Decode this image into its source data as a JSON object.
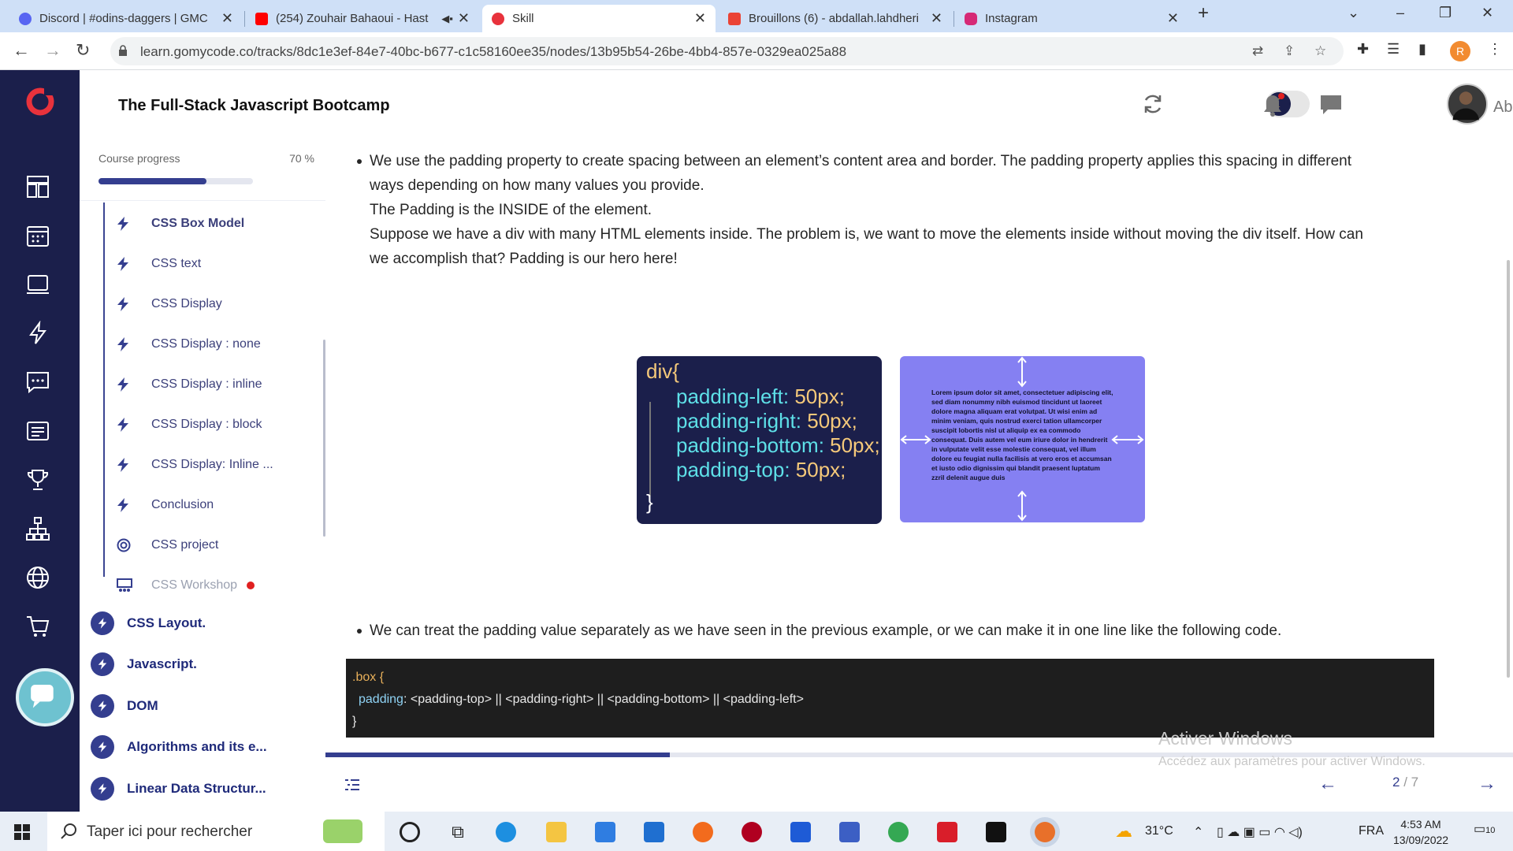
{
  "browser": {
    "tabs": [
      {
        "title": "Discord | #odins-daggers | GMC",
        "favicon": "discord-icon",
        "color": "#5865f2"
      },
      {
        "title": "(254) Zouhair Bahaoui - Hast",
        "favicon": "youtube-icon",
        "color": "#ff0000"
      },
      {
        "title": "Skill",
        "favicon": "gomycode-icon",
        "color": "#e8323c"
      },
      {
        "title": "Brouillons (6) - abdallah.lahdheri",
        "favicon": "gmail-icon",
        "color": "#ea4335"
      },
      {
        "title": "Instagram",
        "favicon": "instagram-icon",
        "color": "#d62976"
      }
    ],
    "url": "learn.gomycode.co/tracks/8dc1e3ef-84e7-40bc-b677-c1c58160ee35/nodes/13b95b54-26be-4bb4-857e-0329ea025a88",
    "profile_initial": "R"
  },
  "header": {
    "course_title": "The Full-Stack Javascript Bootcamp",
    "username": "Abdallah"
  },
  "sidebar": {
    "progress_label": "Course progress",
    "progress_text": "70 %",
    "progress": 0.7,
    "lessons": [
      {
        "label": "CSS Box Model",
        "icon": "bolt-icon",
        "state": "current"
      },
      {
        "label": "CSS text",
        "icon": "bolt-icon",
        "state": "normal"
      },
      {
        "label": "CSS Display",
        "icon": "bolt-icon",
        "state": "normal"
      },
      {
        "label": "CSS Display : none",
        "icon": "bolt-icon",
        "state": "normal"
      },
      {
        "label": "CSS Display : inline",
        "icon": "bolt-icon",
        "state": "normal"
      },
      {
        "label": "CSS Display : block",
        "icon": "bolt-icon",
        "state": "normal"
      },
      {
        "label": "CSS Display: Inline ...",
        "icon": "bolt-icon",
        "state": "normal"
      },
      {
        "label": "Conclusion",
        "icon": "bolt-icon",
        "state": "normal"
      },
      {
        "label": "CSS project",
        "icon": "target-icon",
        "state": "normal"
      },
      {
        "label": "CSS Workshop",
        "icon": "workshop-icon",
        "state": "locked"
      }
    ],
    "modules": [
      {
        "label": "CSS Layout."
      },
      {
        "label": "Javascript."
      },
      {
        "label": "DOM"
      },
      {
        "label": "Algorithms and its e..."
      },
      {
        "label": "Linear Data Structur..."
      }
    ]
  },
  "content": {
    "para1_l1": "We use the padding property to create spacing between an element’s content area and border. The padding property applies this spacing in different",
    "para1_l2": "ways depending on how many values you provide.",
    "para1_l3": "The Padding is the INSIDE of the element.",
    "para1_l4": "Suppose we have a div with many HTML elements inside. The problem is, we want to move the elements inside without moving the div itself. How can",
    "para1_l5": "we accomplish that? Padding is our hero here!",
    "image_code": {
      "open": "div{",
      "lines": [
        {
          "prop": "padding-left",
          "val": "50px;"
        },
        {
          "prop": "padding-right",
          "val": "50px;"
        },
        {
          "prop": "padding-bottom",
          "val": "50px;"
        },
        {
          "prop": "padding-top",
          "val": "50px;"
        }
      ],
      "close": "}"
    },
    "lorem": "Lorem ipsum dolor sit amet, consectetuer adipiscing elit, sed diam nonummy nibh euismod tincidunt ut laoreet dolore magna aliquam erat volutpat. Ut wisi enim ad minim veniam, quis nostrud exerci tation ullamcorper suscipit lobortis nisl ut aliquip ex ea commodo consequat. Duis autem vel eum iriure dolor in hendrerit in vulputate velit esse molestie consequat, vel illum dolore eu feugiat nulla facilisis at vero eros et accumsan et iusto odio dignissim qui blandit praesent luptatum zzril delenit augue duis",
    "para2": "We can treat the padding value separately as we have seen in the previous example, or we can make it in one line like the following code.",
    "snippet": {
      "selector": ".box {",
      "prop": "padding",
      "value": ": <padding-top> || <padding-right> || <padding-bottom> || <padding-left>",
      "close": "}"
    },
    "content_progress": 0.29,
    "page_current": "2",
    "page_total": " / 7"
  },
  "watermark": {
    "title": "Activer Windows",
    "subtitle": "Accédez aux paramètres pour activer Windows."
  },
  "taskbar": {
    "search_placeholder": "Taper ici pour rechercher",
    "temperature": "31°C",
    "language": "FRA",
    "time": "4:53 AM",
    "date": "13/09/2022",
    "notifications": "10"
  }
}
